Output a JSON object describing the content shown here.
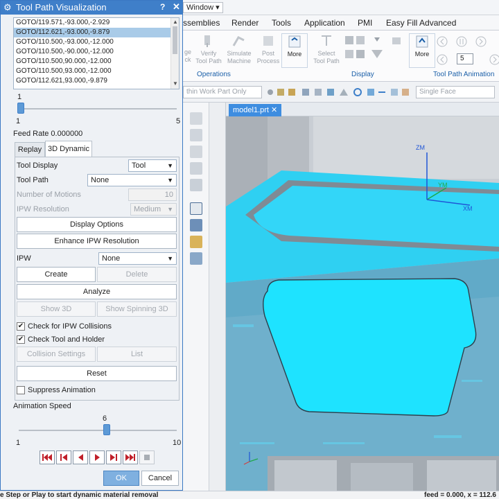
{
  "dialog": {
    "title": "Tool Path Visualization",
    "help": "?",
    "goto_lines": [
      "GOTO/119.571,-93.000,-2.929",
      "GOTO/112.621,-93.000,-9.879",
      "GOTO/110.500,-93.000,-12.000",
      "GOTO/110.500,-90.000,-12.000",
      "GOTO/110.500,90.000,-12.000",
      "GOTO/110.500,93.000,-12.000",
      "GOTO/112.621,93.000,-9.879"
    ],
    "selected_goto_index": 1,
    "step_slider": {
      "value": "1",
      "min": "1",
      "max": "5"
    },
    "feed_rate": "Feed Rate 0.000000",
    "tabs": {
      "replay": "Replay",
      "dynamic": "3D Dynamic"
    },
    "tool_display": {
      "label": "Tool Display",
      "value": "Tool"
    },
    "tool_path": {
      "label": "Tool Path",
      "value": "None"
    },
    "number_of_motions": {
      "label": "Number of Motions",
      "value": "10"
    },
    "ipw_resolution": {
      "label": "IPW Resolution",
      "value": "Medium"
    },
    "display_options": "Display Options",
    "enhance_ipw": "Enhance IPW Resolution",
    "ipw": {
      "label": "IPW",
      "value": "None"
    },
    "create": "Create",
    "delete": "Delete",
    "analyze": "Analyze",
    "show_3d": "Show 3D",
    "show_spinning_3d": "Show Spinning 3D",
    "check_ipw_collisions": {
      "label": "Check for IPW Collisions",
      "checked": true
    },
    "check_tool_holder": {
      "label": "Check Tool and Holder",
      "checked": true
    },
    "collision_settings": "Collision Settings",
    "list": "List",
    "reset": "Reset",
    "suppress_animation": {
      "label": "Suppress Animation",
      "checked": false
    },
    "animation_speed": {
      "label": "Animation Speed",
      "value": "6",
      "min": "1",
      "max": "10",
      "fraction": 0.556
    },
    "ok": "OK",
    "cancel": "Cancel"
  },
  "app": {
    "window_menu": "Window ▾",
    "ribbon_tabs": [
      "ssemblies",
      "Render",
      "Tools",
      "Application",
      "PMI",
      "Easy Fill Advanced"
    ],
    "ribbon_buttons": [
      "ge\nck",
      "Verify\nTool Path",
      "Simulate\nMachine",
      "Post\nProcess",
      "More",
      "Select\nTool Path",
      "More"
    ],
    "groups": {
      "operations": "Operations",
      "display": "Display",
      "animation": "Tool Path Animation"
    },
    "animation_step": "5",
    "filter_combo": "thin Work Part Only",
    "face_combo": "Single Face",
    "view_tab": "model1.prt",
    "axes": {
      "zm": "ZM",
      "ym": "YM",
      "xm": "XM"
    }
  },
  "status": {
    "message": "e Step or Play to start dynamic material removal",
    "feed": "feed = 0.000, x = 112.6"
  }
}
